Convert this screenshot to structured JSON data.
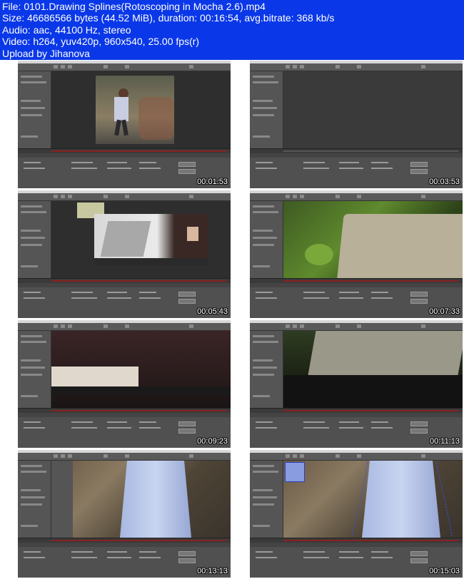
{
  "header": {
    "lines": [
      "File: 0101.Drawing Splines(Rotoscoping in Mocha 2.6).mp4",
      "Size: 46686566 bytes (44.52 MiB), duration: 00:16:54, avg.bitrate: 368 kb/s",
      "Audio: aac, 44100 Hz, stereo",
      "Video: h264, yuv420p, 960x540, 25.00 fps(r)",
      "Upload by Jihanova"
    ]
  },
  "thumbnails": [
    {
      "timestamp": "00:01:53",
      "scene": "girl-walking"
    },
    {
      "timestamp": "00:03:53",
      "scene": "empty-viewer"
    },
    {
      "timestamp": "00:05:43",
      "scene": "laptop-woman"
    },
    {
      "timestamp": "00:07:33",
      "scene": "laptop-plants"
    },
    {
      "timestamp": "00:09:23",
      "scene": "laptop-closeup"
    },
    {
      "timestamp": "00:11:13",
      "scene": "laptop-dark"
    },
    {
      "timestamp": "00:13:13",
      "scene": "dress-rocks"
    },
    {
      "timestamp": "00:15:03",
      "scene": "dress-spline"
    }
  ],
  "colors": {
    "background": "#0a38e8",
    "text": "#ffffff"
  }
}
